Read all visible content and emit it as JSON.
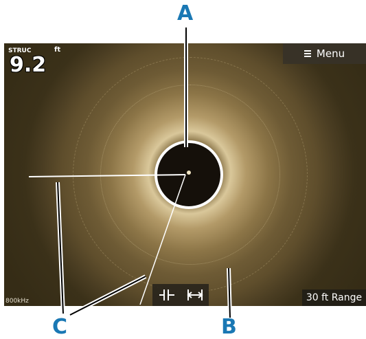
{
  "display": {
    "mode_label": "STRUC",
    "depth_unit": "ft",
    "depth_value": "9.2",
    "frequency": "800kHz",
    "range_label": "30 ft Range",
    "menu_label": "Menu"
  },
  "measure_controls": {
    "buttons": [
      "measure-start-icon",
      "measure-distance-icon"
    ]
  },
  "callouts": {
    "a": "A",
    "b": "B",
    "c": "C"
  },
  "colors": {
    "callout": "#1a78b4",
    "sonar_background": "#352c16",
    "sonar_highlight": "#d9c79a"
  }
}
